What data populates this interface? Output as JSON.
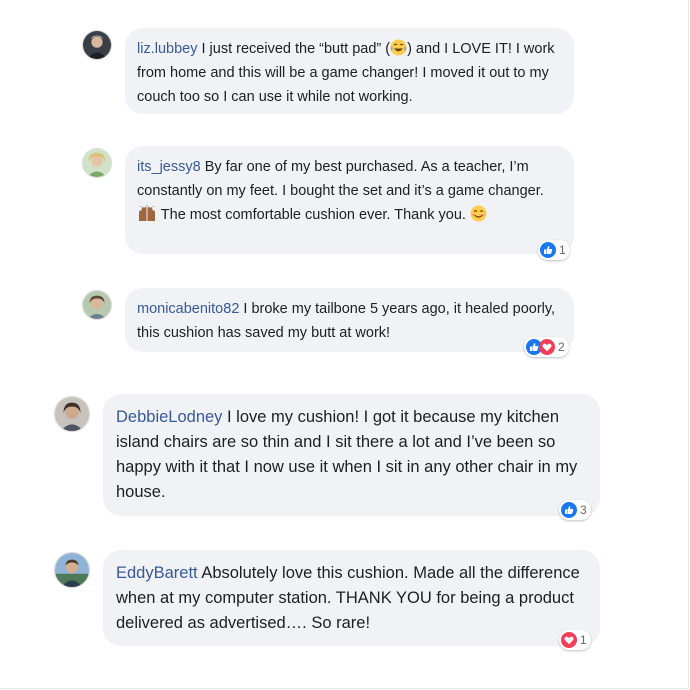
{
  "colors": {
    "bubble_bg": "#f0f2f5",
    "username": "#385898",
    "text": "#1c1e21",
    "like_blue": "#1877f2",
    "love_red": "#f33e58"
  },
  "comments": [
    {
      "user": "liz.lubbey",
      "text": [
        {
          "t": "I just received the “butt pad” ("
        },
        {
          "emoji": "tears-of-joy-emoji"
        },
        {
          "t": ") and I LOVE IT! I work from home and this will be a game changer! I moved it out to my couch too so I can use it while not working."
        }
      ],
      "reactions": null
    },
    {
      "user": "its_jessy8",
      "text": [
        {
          "t": "By far one of my best purchased. As a teacher, I’m constantly on my feet. I bought the set and it’s a game changer. "
        },
        {
          "emoji": "raising-hands-emoji"
        },
        {
          "t": " The most comfortable cushion ever. Thank you. "
        },
        {
          "emoji": "smiling-face-emoji"
        }
      ],
      "reactions": {
        "icons": [
          "like-icon"
        ],
        "count": "1"
      }
    },
    {
      "user": "monicabenito82",
      "text": [
        {
          "t": "I broke my tailbone 5 years ago, it healed poorly, this cushion has saved my butt at work!"
        }
      ],
      "reactions": {
        "icons": [
          "like-icon",
          "love-icon"
        ],
        "count": "2"
      }
    },
    {
      "user": "DebbieLodney",
      "text": [
        {
          "t": "I love my cushion! I got it because my kitchen island chairs are so thin and I sit there a lot and I’ve been so happy with it that I now use it when I sit in any other chair in my house."
        }
      ],
      "reactions": {
        "icons": [
          "like-icon"
        ],
        "count": "3"
      }
    },
    {
      "user": "EddyBarett",
      "text": [
        {
          "t": "Absolutely love this cushion. Made all the difference when at my computer station. THANK YOU for being a product delivered as advertised…. So rare!"
        }
      ],
      "reactions": {
        "icons": [
          "love-icon"
        ],
        "count": "1"
      }
    }
  ]
}
